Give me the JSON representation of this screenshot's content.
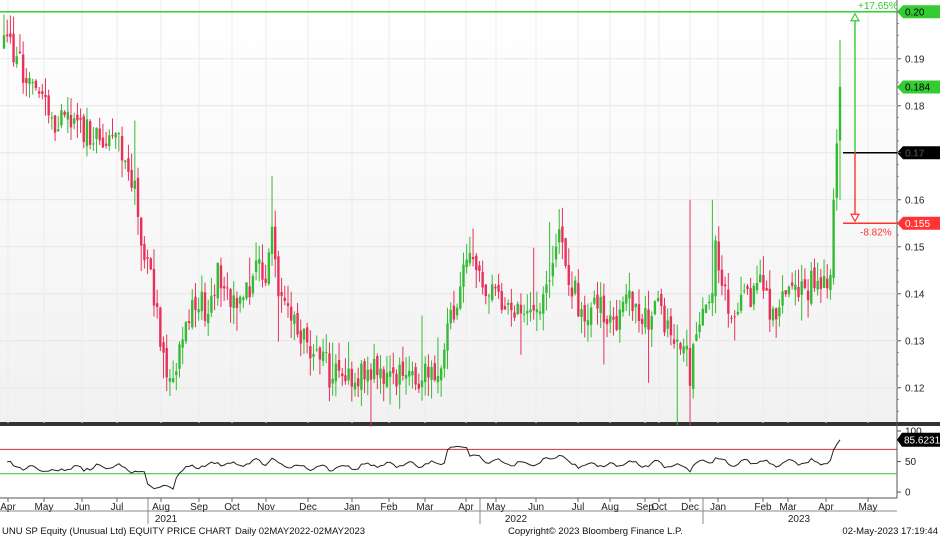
{
  "chart_data": {
    "type": "candlestick",
    "title": "UNU SP Equity (Unusual Ltd) EQUITY PRICE CHART",
    "period": "Daily 02MAY2022-02MAY2023",
    "copyright": "Copyright© 2023 Bloomberg Finance L.P.",
    "timestamp": "02-May-2023  17:19:44",
    "months": [
      "Apr",
      "May",
      "Jun",
      "Jul",
      "Aug",
      "Sep",
      "Oct",
      "Nov",
      "Dec",
      "Jan",
      "Feb",
      "Mar",
      "Apr",
      "May",
      "Jun",
      "Jul",
      "Aug",
      "Sep",
      "Oct",
      "Dec",
      "Jan",
      "Feb",
      "Mar",
      "Apr",
      "May"
    ],
    "years": [
      "2021",
      "2022",
      "2023"
    ],
    "price_axis": {
      "ticks": [
        0.12,
        0.13,
        0.14,
        0.15,
        0.16,
        0.17,
        0.18,
        0.19
      ],
      "range": [
        0.1125,
        0.2025
      ]
    },
    "price_levels": [
      {
        "name": "high",
        "value": 0.2,
        "label": "0.20",
        "color": "#33cc33"
      },
      {
        "name": "last",
        "value": 0.184,
        "label": "0.184",
        "color": "#33cc33"
      },
      {
        "name": "reference",
        "value": 0.17,
        "label": "0.17",
        "color": "#000000"
      },
      {
        "name": "low",
        "value": 0.155,
        "label": "0.155",
        "color": "#ff3333"
      }
    ],
    "measures": [
      {
        "label": "+17.65%",
        "color": "#33cc33"
      },
      {
        "label": "-8.82%",
        "color": "#ff3333"
      }
    ],
    "rsi": {
      "label": "85.6231",
      "value": 85.6231,
      "ticks": [
        0,
        50,
        100
      ],
      "upper_band": 70,
      "lower_band": 30
    },
    "price_path": [
      [
        0,
        0.193
      ],
      [
        3,
        0.191
      ],
      [
        7,
        0.186
      ],
      [
        10,
        0.184
      ],
      [
        13,
        0.181
      ],
      [
        16,
        0.177
      ],
      [
        20,
        0.179
      ],
      [
        24,
        0.176
      ],
      [
        28,
        0.173
      ],
      [
        32,
        0.172
      ],
      [
        36,
        0.173
      ],
      [
        39,
        0.168
      ],
      [
        41,
        0.162
      ],
      [
        43,
        0.152
      ],
      [
        45,
        0.148
      ],
      [
        47,
        0.14
      ],
      [
        49,
        0.131
      ],
      [
        51,
        0.125
      ],
      [
        53,
        0.121
      ],
      [
        55,
        0.127
      ],
      [
        57,
        0.133
      ],
      [
        59,
        0.136
      ],
      [
        61,
        0.139
      ],
      [
        63,
        0.136
      ],
      [
        65,
        0.141
      ],
      [
        67,
        0.144
      ],
      [
        69,
        0.14
      ],
      [
        71,
        0.137
      ],
      [
        73,
        0.138
      ],
      [
        75,
        0.139
      ],
      [
        77,
        0.142
      ],
      [
        79,
        0.145
      ],
      [
        81,
        0.144
      ],
      [
        83,
        0.146
      ],
      [
        84,
        0.156
      ],
      [
        86,
        0.141
      ],
      [
        88,
        0.136
      ],
      [
        90,
        0.134
      ],
      [
        92,
        0.132
      ],
      [
        94,
        0.13
      ],
      [
        96,
        0.125
      ],
      [
        98,
        0.126
      ],
      [
        100,
        0.127
      ],
      [
        102,
        0.123
      ],
      [
        104,
        0.125
      ],
      [
        106,
        0.124
      ],
      [
        108,
        0.124
      ],
      [
        110,
        0.122
      ],
      [
        112,
        0.123
      ],
      [
        114,
        0.124
      ],
      [
        116,
        0.125
      ],
      [
        118,
        0.123
      ],
      [
        120,
        0.124
      ],
      [
        122,
        0.122
      ],
      [
        124,
        0.123
      ],
      [
        126,
        0.123
      ],
      [
        128,
        0.123
      ],
      [
        130,
        0.122
      ],
      [
        132,
        0.123
      ],
      [
        134,
        0.124
      ],
      [
        136,
        0.121
      ],
      [
        138,
        0.128
      ],
      [
        140,
        0.136
      ],
      [
        142,
        0.139
      ],
      [
        144,
        0.145
      ],
      [
        146,
        0.148
      ],
      [
        148,
        0.146
      ],
      [
        150,
        0.142
      ],
      [
        152,
        0.14
      ],
      [
        154,
        0.141
      ],
      [
        156,
        0.138
      ],
      [
        158,
        0.139
      ],
      [
        160,
        0.136
      ],
      [
        162,
        0.137
      ],
      [
        164,
        0.134
      ],
      [
        166,
        0.137
      ],
      [
        168,
        0.138
      ],
      [
        170,
        0.142
      ],
      [
        172,
        0.146
      ],
      [
        174,
        0.151
      ],
      [
        176,
        0.146
      ],
      [
        178,
        0.142
      ],
      [
        180,
        0.138
      ],
      [
        182,
        0.136
      ],
      [
        184,
        0.135
      ],
      [
        186,
        0.138
      ],
      [
        188,
        0.136
      ],
      [
        190,
        0.134
      ],
      [
        192,
        0.133
      ],
      [
        194,
        0.136
      ],
      [
        196,
        0.138
      ],
      [
        198,
        0.137
      ],
      [
        200,
        0.134
      ],
      [
        202,
        0.135
      ],
      [
        204,
        0.139
      ],
      [
        206,
        0.136
      ],
      [
        208,
        0.133
      ],
      [
        210,
        0.131
      ],
      [
        212,
        0.127
      ],
      [
        214,
        0.129
      ],
      [
        215,
        0.123
      ],
      [
        217,
        0.13
      ],
      [
        219,
        0.134
      ],
      [
        221,
        0.137
      ],
      [
        222,
        0.141
      ],
      [
        223,
        0.151
      ],
      [
        225,
        0.142
      ],
      [
        227,
        0.137
      ],
      [
        229,
        0.135
      ],
      [
        231,
        0.137
      ],
      [
        233,
        0.139
      ],
      [
        235,
        0.141
      ],
      [
        237,
        0.142
      ],
      [
        239,
        0.138
      ],
      [
        241,
        0.136
      ],
      [
        243,
        0.137
      ],
      [
        245,
        0.138
      ],
      [
        247,
        0.14
      ],
      [
        249,
        0.139
      ],
      [
        251,
        0.141
      ],
      [
        253,
        0.142
      ],
      [
        255,
        0.142
      ],
      [
        257,
        0.143
      ],
      [
        259,
        0.144
      ],
      [
        260,
        0.16
      ],
      [
        261,
        0.172
      ],
      [
        262,
        0.184
      ]
    ]
  }
}
